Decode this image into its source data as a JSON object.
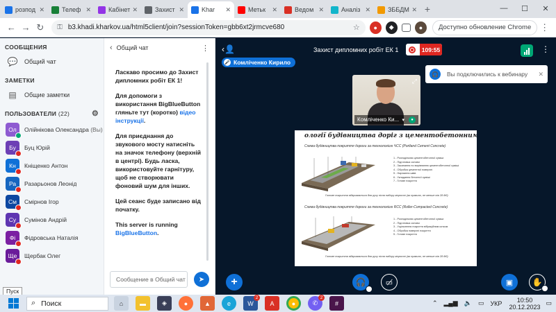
{
  "browser": {
    "tabs": [
      {
        "title": "розпод",
        "color": "#1a73e8"
      },
      {
        "title": "Телеф",
        "color": "#188038"
      },
      {
        "title": "Кабінет",
        "color": "#9334e6"
      },
      {
        "title": "Захист",
        "color": "#5f6368"
      },
      {
        "title": "Khar",
        "color": "#1a73e8",
        "active": true
      },
      {
        "title": "Метьк",
        "color": "#ff0000"
      },
      {
        "title": "Ведом",
        "color": "#d93025"
      },
      {
        "title": "Аналіз",
        "color": "#12b5cb"
      },
      {
        "title": "ЗББДМ",
        "color": "#f29900"
      }
    ],
    "url": "b3.khadi.kharkov.ua/html5client/join?sessionToken=gbb6xt2jrmcve680",
    "update_label": "Доступно обновление Chrome"
  },
  "sidebar": {
    "messages_heading": "СООБЩЕНИЯ",
    "public_chat": "Общий чат",
    "notes_heading": "ЗАМЕТКИ",
    "shared_notes": "Общие заметки",
    "users_heading": "ПОЛЬЗОВАТЕЛИ",
    "users_count": "(22)",
    "users": [
      {
        "initials": "Ол",
        "name": "Олійнікова Олександра",
        "suffix": " (Вы)",
        "color": "#8e5bd1"
      },
      {
        "initials": "Бу",
        "name": "Буц Юрій",
        "suffix": "",
        "color": "#6d3fb5"
      },
      {
        "initials": "Кн",
        "name": "Кніщенко Антон",
        "suffix": "",
        "color": "#0F70D7"
      },
      {
        "initials": "Ра",
        "name": "Разарьонов Леонід",
        "suffix": "",
        "color": "#1565c0"
      },
      {
        "initials": "См",
        "name": "Смірнов Ігор",
        "suffix": "",
        "color": "#0d47a1"
      },
      {
        "initials": "Су",
        "name": "Сумінов Андрій",
        "suffix": "",
        "color": "#5e35b1"
      },
      {
        "initials": "Фі",
        "name": "Фідровська Наталія",
        "suffix": "",
        "color": "#7b1fa2"
      },
      {
        "initials": "Ще",
        "name": "Щербак Олег",
        "suffix": "",
        "color": "#6a1b9a"
      }
    ]
  },
  "chat": {
    "title": "Общий чат",
    "welcome_1": "Ласкаво просимо до Захист дипломних робіт ЕК 1!",
    "help_text": "Для допомоги з використання BigBlueButton гляньте тут (коротко)",
    "help_link": "відео інструкції",
    "help_end": ".",
    "audio_text": "Для приєднання до звукового мосту натисніть на значок телефону (верхній в центрі). Будь ласка, використовуйте гарнітуру, щоб не створювати фоновий шум для інших.",
    "record_text": "Цей сеанс буде записано від початку.",
    "server_text": "This server is running",
    "server_link": "BigBlueButton",
    "server_end": ".",
    "input_placeholder": "Сообщение в Общий чат"
  },
  "meeting": {
    "title": "Захист дипломних робіт ЕК 1",
    "timer": "109:55",
    "presenter": "Комліченко Кирило",
    "webcam_name": "Комліченко Ки...",
    "toast": "Вы подключились к вебинару"
  },
  "slide": {
    "title": "ології будівництва доріг з цементобетонним покриттям",
    "subtitle_1": "Схема будівництва покриття дороги за технологією ЧСС (Portland Cement Concrete)",
    "legend_1": [
      "1 - Розподільник цементобетонної суміші",
      "2 - Підготовка основи",
      "3 - Засипання по вирівнянню цементобетонної суміші",
      "4 - Обробка цементної поверхні",
      "5 - Нарізання швів",
      "6 - Укладання бетонної суміші",
      "7 - Готове покриття"
    ],
    "foot_1": "Готове покриття відкривається для руху після набору міцності (як правило, не менше ніж 28 діб)",
    "subtitle_2": "Схема будівництва покриття дороги за технологією RCC (Roller-Compacted Concrete)",
    "legend_2": [
      "1 - Розподільник цементобетонної суміші",
      "2 - Підготовка основи",
      "3 - Ущільнення покриття вібраційним котком",
      "4 - Обробка поверхні покриття",
      "5 - Готове покриття"
    ],
    "foot_2": "Готове покриття відкривається для руху після набору міцності (як правило, не менше ніж 28 діб)"
  },
  "taskbar": {
    "search_label": "Поиск",
    "tooltip": "Пуск",
    "lang": "УКР",
    "time": "10:50",
    "date": "20.12.2023",
    "word_badge": "2",
    "chrome_badge": "2"
  },
  "colors": {
    "accent": "#0F70D7",
    "bbb_dark": "#06172A",
    "record": "#DF2721",
    "connection": "#00A775"
  }
}
